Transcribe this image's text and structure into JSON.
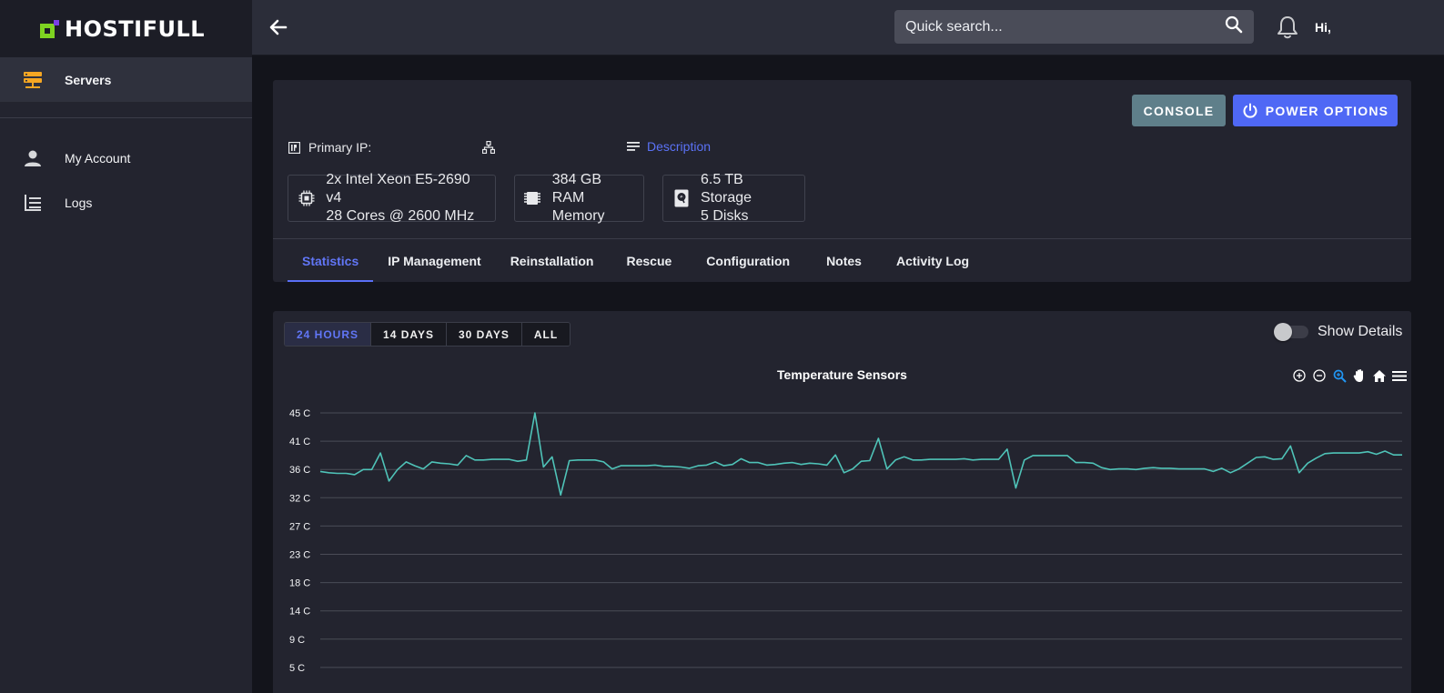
{
  "brand": {
    "name": "HOSTIFULL"
  },
  "sidebar": {
    "items": [
      {
        "label": "Servers",
        "icon": "server-icon",
        "active": true
      },
      {
        "label": "My Account",
        "icon": "user-icon"
      },
      {
        "label": "Logs",
        "icon": "logs-icon"
      }
    ]
  },
  "topbar": {
    "search_placeholder": "Quick search...",
    "greeting": "Hi,"
  },
  "server": {
    "console_label": "Console",
    "power_label": "Power Options",
    "primary_ip_label": "Primary IP:",
    "description_label": "Description",
    "specs": [
      {
        "icon": "cpu-icon",
        "line1": "2x Intel Xeon E5-2690 v4",
        "line2": "28 Cores @ 2600 MHz"
      },
      {
        "icon": "memory-icon",
        "line1": "384 GB RAM",
        "line2": "Memory"
      },
      {
        "icon": "storage-icon",
        "line1": "6.5 TB Storage",
        "line2": "5 Disks"
      }
    ],
    "tabs": [
      "Statistics",
      "IP Management",
      "Reinstallation",
      "Rescue",
      "Configuration",
      "Notes",
      "Activity Log"
    ],
    "active_tab": "Statistics"
  },
  "stats": {
    "ranges": [
      "24 Hours",
      "14 Days",
      "30 Days",
      "All"
    ],
    "active_range": "24 Hours",
    "show_details_label": "Show Details",
    "show_details_on": false
  },
  "colors": {
    "accent": "#5b72f6",
    "line": "#4fc3b8",
    "brand_green": "#7ed321",
    "brand_purple": "#7b3fe4"
  },
  "chart_data": {
    "type": "line",
    "title": "Temperature Sensors",
    "ylabel": "",
    "xlabel": "",
    "y_ticks": [
      "45 C",
      "41 C",
      "36 C",
      "32 C",
      "27 C",
      "23 C",
      "18 C",
      "14 C",
      "9 C",
      "5 C"
    ],
    "ylim": [
      5,
      45
    ],
    "grid": true,
    "series": [
      {
        "values": [
          35.8,
          35.6,
          35.5,
          35.5,
          35.3,
          36.1,
          36.1,
          38.7,
          34.3,
          36.1,
          37.3,
          36.7,
          36.2,
          37.3,
          37.1,
          37.0,
          36.8,
          38.3,
          37.6,
          37.6,
          37.7,
          37.7,
          37.7,
          37.4,
          37.6,
          45.0,
          36.5,
          38.1,
          32.1,
          37.5,
          37.6,
          37.6,
          37.6,
          37.3,
          36.2,
          36.7,
          36.7,
          36.7,
          36.7,
          36.8,
          36.6,
          36.6,
          36.5,
          36.3,
          36.7,
          36.8,
          37.3,
          36.7,
          36.9,
          37.8,
          37.2,
          37.2,
          36.8,
          36.9,
          37.1,
          37.2,
          36.9,
          37.1,
          37.0,
          36.8,
          38.4,
          35.6,
          36.2,
          37.4,
          37.5,
          41.0,
          36.2,
          37.6,
          38.1,
          37.6,
          37.6,
          37.7,
          37.7,
          37.7,
          37.7,
          37.8,
          37.6,
          37.7,
          37.7,
          37.7,
          39.3,
          33.2,
          37.6,
          38.3,
          38.3,
          38.3,
          38.3,
          38.3,
          37.2,
          37.2,
          37.1,
          36.4,
          36.1,
          36.2,
          36.2,
          36.1,
          36.3,
          36.4,
          36.3,
          36.3,
          36.2,
          36.2,
          36.2,
          36.2,
          35.8,
          36.3,
          35.6,
          36.2,
          37.1,
          38.0,
          38.1,
          37.7,
          37.8,
          39.8,
          35.6,
          37.1,
          37.9,
          38.6,
          38.7,
          38.7,
          38.7,
          38.7,
          38.9,
          38.5,
          39.0,
          38.4,
          38.4
        ]
      }
    ]
  }
}
